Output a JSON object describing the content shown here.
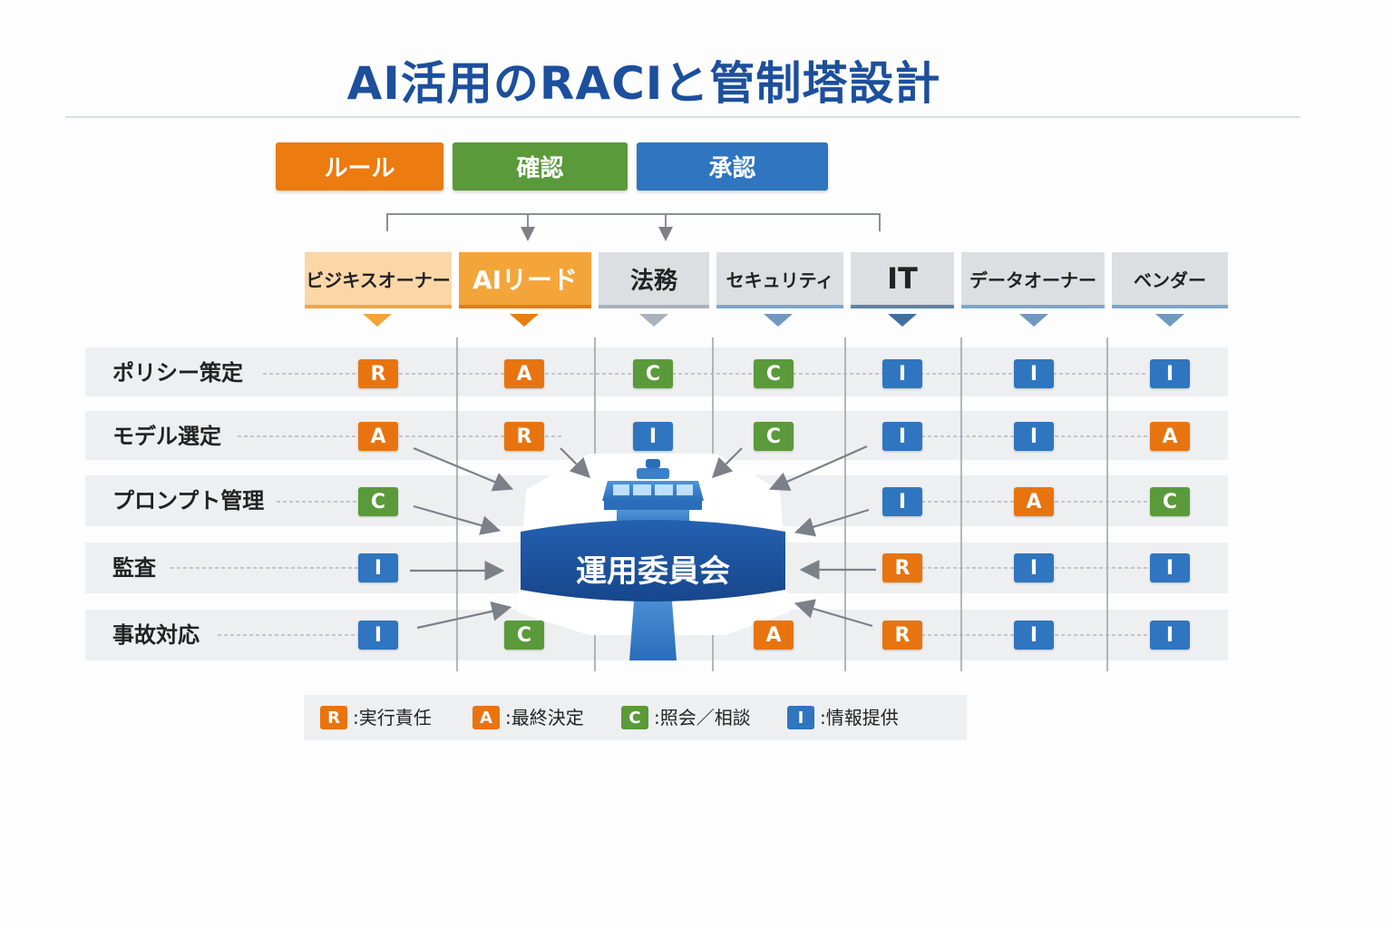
{
  "title": "AI活用のRACIと管制塔設計",
  "top_buttons": [
    {
      "label": "ルール",
      "color": "#ec7b10"
    },
    {
      "label": "確認",
      "color": "#5a9a3a"
    },
    {
      "label": "承認",
      "color": "#2f75c0"
    }
  ],
  "roles": [
    {
      "label": "ビジキスオーナー",
      "bg": "#fbd7a8"
    },
    {
      "label": "AIリード",
      "bg": "#f3a53a"
    },
    {
      "label": "法務",
      "bg": "#dcdee1"
    },
    {
      "label": "セキュリティ",
      "bg": "#dcdee1"
    },
    {
      "label": "IT",
      "bg": "#dcdee1"
    },
    {
      "label": "データオーナー",
      "bg": "#dcdee1"
    },
    {
      "label": "ベンダー",
      "bg": "#dcdee1"
    }
  ],
  "rows": [
    {
      "label": "ポリシー策定",
      "cells": [
        "R",
        "A",
        "C",
        "C",
        "I",
        "I",
        "I"
      ]
    },
    {
      "label": "モデル選定",
      "cells": [
        "A",
        "R",
        "I",
        "C",
        "I",
        "I",
        "A"
      ]
    },
    {
      "label": "プロンプト管理",
      "cells": [
        "C",
        "",
        "",
        "",
        "I",
        "A",
        "C"
      ]
    },
    {
      "label": "監査",
      "cells": [
        "I",
        "",
        "",
        "",
        "R",
        "I",
        "I"
      ]
    },
    {
      "label": "事故対応",
      "cells": [
        "I",
        "C",
        "",
        "A",
        "R",
        "I",
        "I"
      ]
    }
  ],
  "center_hub": "運用委員会",
  "legend": [
    {
      "key": "R",
      "text": ":実行責任"
    },
    {
      "key": "A",
      "text": ":最終決定"
    },
    {
      "key": "C",
      "text": ":照会／相談"
    },
    {
      "key": "I",
      "text": ":情報提供"
    }
  ],
  "colors": {
    "R": "#e8740f",
    "A": "#e8740f",
    "C": "#5a9a3a",
    "I": "#2f75c0",
    "title": "#1c4f9c",
    "hub": "#1b4f9e"
  }
}
